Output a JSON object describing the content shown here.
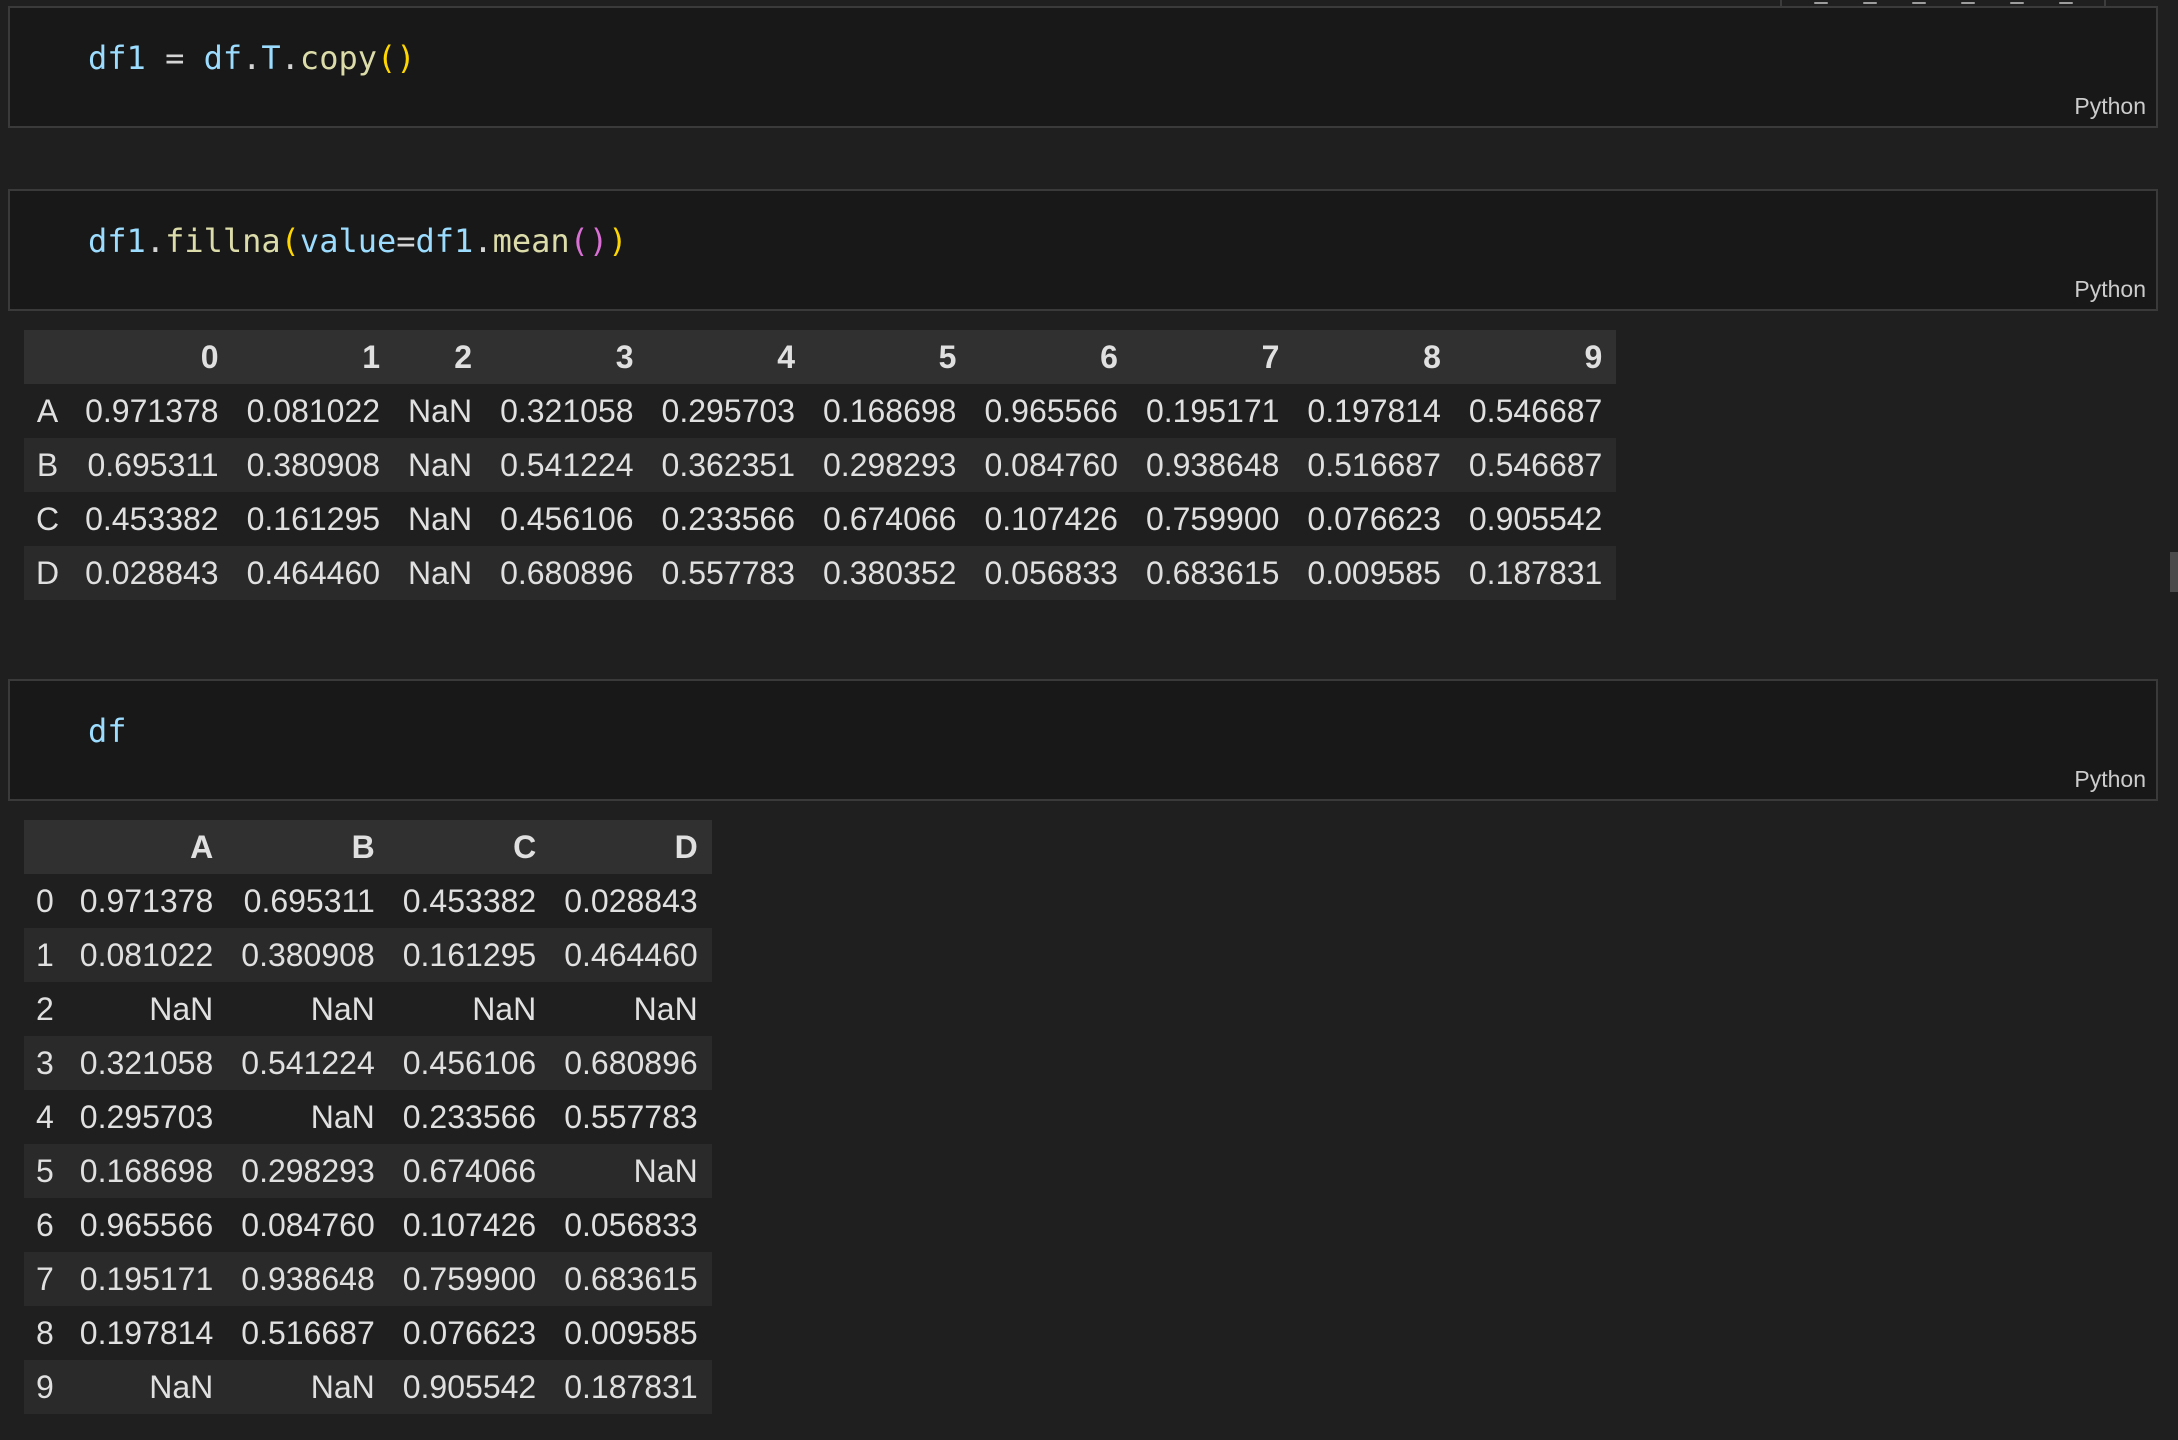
{
  "cells": [
    {
      "code_tokens": [
        {
          "t": "df1",
          "c": "tok-var"
        },
        {
          "t": " = ",
          "c": "tok-op"
        },
        {
          "t": "df",
          "c": "tok-var"
        },
        {
          "t": ".",
          "c": "tok-op"
        },
        {
          "t": "T",
          "c": "tok-var"
        },
        {
          "t": ".",
          "c": "tok-op"
        },
        {
          "t": "copy",
          "c": "tok-fn"
        },
        {
          "t": "()",
          "c": "tok-p1"
        }
      ],
      "language": "Python"
    },
    {
      "code_tokens": [
        {
          "t": "df1",
          "c": "tok-var"
        },
        {
          "t": ".",
          "c": "tok-op"
        },
        {
          "t": "fillna",
          "c": "tok-fn"
        },
        {
          "t": "(",
          "c": "tok-p1"
        },
        {
          "t": "value",
          "c": "tok-var"
        },
        {
          "t": "=",
          "c": "tok-op"
        },
        {
          "t": "df1",
          "c": "tok-var"
        },
        {
          "t": ".",
          "c": "tok-op"
        },
        {
          "t": "mean",
          "c": "tok-fn"
        },
        {
          "t": "()",
          "c": "tok-p2"
        },
        {
          "t": ")",
          "c": "tok-p1"
        }
      ],
      "language": "Python",
      "output": {
        "columns": [
          "",
          "0",
          "1",
          "2",
          "3",
          "4",
          "5",
          "6",
          "7",
          "8",
          "9"
        ],
        "rows": [
          [
            "A",
            "0.971378",
            "0.081022",
            "NaN",
            "0.321058",
            "0.295703",
            "0.168698",
            "0.965566",
            "0.195171",
            "0.197814",
            "0.546687"
          ],
          [
            "B",
            "0.695311",
            "0.380908",
            "NaN",
            "0.541224",
            "0.362351",
            "0.298293",
            "0.084760",
            "0.938648",
            "0.516687",
            "0.546687"
          ],
          [
            "C",
            "0.453382",
            "0.161295",
            "NaN",
            "0.456106",
            "0.233566",
            "0.674066",
            "0.107426",
            "0.759900",
            "0.076623",
            "0.905542"
          ],
          [
            "D",
            "0.028843",
            "0.464460",
            "NaN",
            "0.680896",
            "0.557783",
            "0.380352",
            "0.056833",
            "0.683615",
            "0.009585",
            "0.187831"
          ]
        ]
      }
    },
    {
      "code_tokens": [
        {
          "t": "df",
          "c": "tok-var"
        }
      ],
      "language": "Python",
      "output": {
        "columns": [
          "",
          "A",
          "B",
          "C",
          "D"
        ],
        "rows": [
          [
            "0",
            "0.971378",
            "0.695311",
            "0.453382",
            "0.028843"
          ],
          [
            "1",
            "0.081022",
            "0.380908",
            "0.161295",
            "0.464460"
          ],
          [
            "2",
            "NaN",
            "NaN",
            "NaN",
            "NaN"
          ],
          [
            "3",
            "0.321058",
            "0.541224",
            "0.456106",
            "0.680896"
          ],
          [
            "4",
            "0.295703",
            "NaN",
            "0.233566",
            "0.557783"
          ],
          [
            "5",
            "0.168698",
            "0.298293",
            "0.674066",
            "NaN"
          ],
          [
            "6",
            "0.965566",
            "0.084760",
            "0.107426",
            "0.056833"
          ],
          [
            "7",
            "0.195171",
            "0.938648",
            "0.759900",
            "0.683615"
          ],
          [
            "8",
            "0.197814",
            "0.516687",
            "0.076623",
            "0.009585"
          ],
          [
            "9",
            "NaN",
            "NaN",
            "0.905542",
            "0.187831"
          ]
        ]
      }
    }
  ],
  "toolbar": {
    "icons": [
      "run-by-line-icon",
      "execute-above-icon",
      "execute-below-icon",
      "split-cell-icon",
      "more-actions-icon",
      "delete-cell-icon"
    ]
  }
}
